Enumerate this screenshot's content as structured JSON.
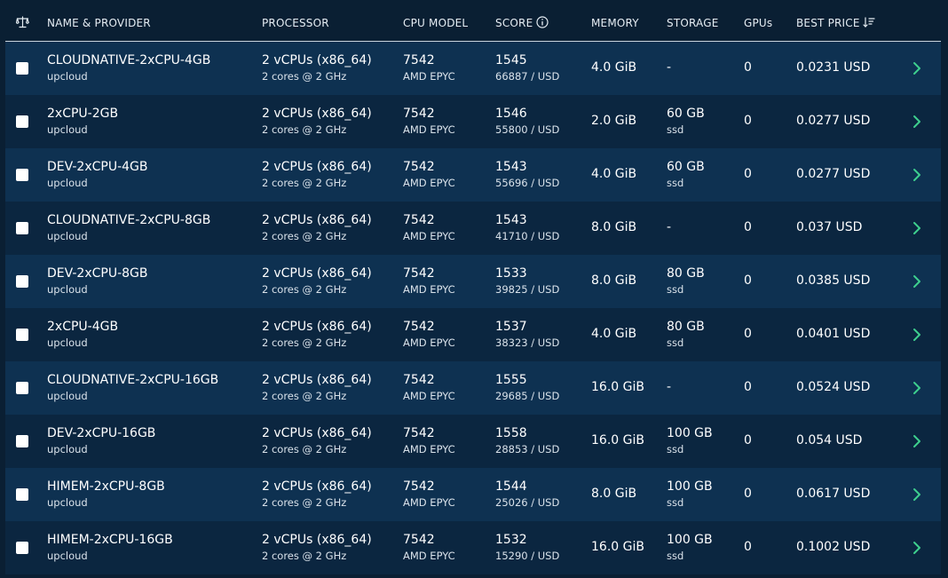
{
  "header": {
    "compare_icon": "balance-scale-icon",
    "name": "NAME & PROVIDER",
    "processor": "PROCESSOR",
    "cpu_model": "CPU MODEL",
    "score": "SCORE",
    "memory": "MEMORY",
    "storage": "STORAGE",
    "gpus": "GPUs",
    "best_price": "BEST PRICE"
  },
  "colors": {
    "background": "#0a1f33",
    "row_a": "#0e3151",
    "row_b": "#0b2640",
    "chevron": "#3ecf8e"
  },
  "rows": [
    {
      "name": "CLOUDNATIVE-2xCPU-4GB",
      "provider": "upcloud",
      "processor": "2 vCPUs (x86_64)",
      "cores": "2 cores @ 2 GHz",
      "cpu_model": "7542",
      "cpu_vendor": "AMD EPYC",
      "score": "1545",
      "score_per_usd": "66887 / USD",
      "memory": "4.0 GiB",
      "storage": "-",
      "storage_type": "",
      "gpus": "0",
      "price": "0.0231 USD"
    },
    {
      "name": "2xCPU-2GB",
      "provider": "upcloud",
      "processor": "2 vCPUs (x86_64)",
      "cores": "2 cores @ 2 GHz",
      "cpu_model": "7542",
      "cpu_vendor": "AMD EPYC",
      "score": "1546",
      "score_per_usd": "55800 / USD",
      "memory": "2.0 GiB",
      "storage": "60 GB",
      "storage_type": "ssd",
      "gpus": "0",
      "price": "0.0277 USD"
    },
    {
      "name": "DEV-2xCPU-4GB",
      "provider": "upcloud",
      "processor": "2 vCPUs (x86_64)",
      "cores": "2 cores @ 2 GHz",
      "cpu_model": "7542",
      "cpu_vendor": "AMD EPYC",
      "score": "1543",
      "score_per_usd": "55696 / USD",
      "memory": "4.0 GiB",
      "storage": "60 GB",
      "storage_type": "ssd",
      "gpus": "0",
      "price": "0.0277 USD"
    },
    {
      "name": "CLOUDNATIVE-2xCPU-8GB",
      "provider": "upcloud",
      "processor": "2 vCPUs (x86_64)",
      "cores": "2 cores @ 2 GHz",
      "cpu_model": "7542",
      "cpu_vendor": "AMD EPYC",
      "score": "1543",
      "score_per_usd": "41710 / USD",
      "memory": "8.0 GiB",
      "storage": "-",
      "storage_type": "",
      "gpus": "0",
      "price": "0.037 USD"
    },
    {
      "name": "DEV-2xCPU-8GB",
      "provider": "upcloud",
      "processor": "2 vCPUs (x86_64)",
      "cores": "2 cores @ 2 GHz",
      "cpu_model": "7542",
      "cpu_vendor": "AMD EPYC",
      "score": "1533",
      "score_per_usd": "39825 / USD",
      "memory": "8.0 GiB",
      "storage": "80 GB",
      "storage_type": "ssd",
      "gpus": "0",
      "price": "0.0385 USD"
    },
    {
      "name": "2xCPU-4GB",
      "provider": "upcloud",
      "processor": "2 vCPUs (x86_64)",
      "cores": "2 cores @ 2 GHz",
      "cpu_model": "7542",
      "cpu_vendor": "AMD EPYC",
      "score": "1537",
      "score_per_usd": "38323 / USD",
      "memory": "4.0 GiB",
      "storage": "80 GB",
      "storage_type": "ssd",
      "gpus": "0",
      "price": "0.0401 USD"
    },
    {
      "name": "CLOUDNATIVE-2xCPU-16GB",
      "provider": "upcloud",
      "processor": "2 vCPUs (x86_64)",
      "cores": "2 cores @ 2 GHz",
      "cpu_model": "7542",
      "cpu_vendor": "AMD EPYC",
      "score": "1555",
      "score_per_usd": "29685 / USD",
      "memory": "16.0 GiB",
      "storage": "-",
      "storage_type": "",
      "gpus": "0",
      "price": "0.0524 USD"
    },
    {
      "name": "DEV-2xCPU-16GB",
      "provider": "upcloud",
      "processor": "2 vCPUs (x86_64)",
      "cores": "2 cores @ 2 GHz",
      "cpu_model": "7542",
      "cpu_vendor": "AMD EPYC",
      "score": "1558",
      "score_per_usd": "28853 / USD",
      "memory": "16.0 GiB",
      "storage": "100 GB",
      "storage_type": "ssd",
      "gpus": "0",
      "price": "0.054 USD"
    },
    {
      "name": "HIMEM-2xCPU-8GB",
      "provider": "upcloud",
      "processor": "2 vCPUs (x86_64)",
      "cores": "2 cores @ 2 GHz",
      "cpu_model": "7542",
      "cpu_vendor": "AMD EPYC",
      "score": "1544",
      "score_per_usd": "25026 / USD",
      "memory": "8.0 GiB",
      "storage": "100 GB",
      "storage_type": "ssd",
      "gpus": "0",
      "price": "0.0617 USD"
    },
    {
      "name": "HIMEM-2xCPU-16GB",
      "provider": "upcloud",
      "processor": "2 vCPUs (x86_64)",
      "cores": "2 cores @ 2 GHz",
      "cpu_model": "7542",
      "cpu_vendor": "AMD EPYC",
      "score": "1532",
      "score_per_usd": "15290 / USD",
      "memory": "16.0 GiB",
      "storage": "100 GB",
      "storage_type": "ssd",
      "gpus": "0",
      "price": "0.1002 USD"
    }
  ]
}
